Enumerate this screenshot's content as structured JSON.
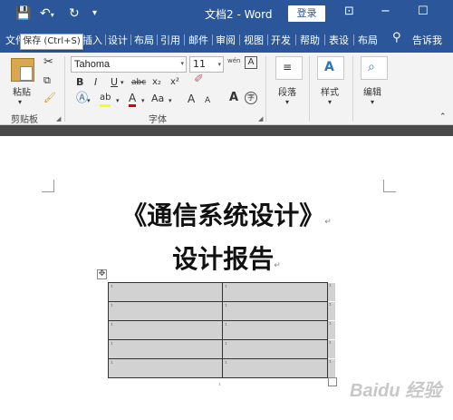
{
  "titlebar": {
    "save_icon": "save-icon",
    "undo_icon": "undo-icon",
    "redo_icon": "redo-icon",
    "customize_icon": "customize-qat-icon",
    "title": "文档2  -  Word",
    "login_label": "登录",
    "ribbon_display_icon": "ribbon-display-icon",
    "minimize_label": "−",
    "maximize_label": "☐"
  },
  "tooltip": "保存 (Ctrl+S)",
  "tabs": [
    "文件",
    "插入",
    "设计",
    "布局",
    "引用",
    "邮件",
    "审阅",
    "视图",
    "开发",
    "帮助",
    "表设",
    "布局"
  ],
  "tell_me_label": "告诉我",
  "ribbon": {
    "clipboard": {
      "paste_label": "粘贴",
      "group_label": "剪贴板"
    },
    "font": {
      "font_name": "Tahoma",
      "font_size": "11",
      "group_label": "字体",
      "pinyin_label": "wén",
      "bold": "B",
      "italic": "I",
      "underline": "U",
      "strikethrough": "abc",
      "subscript": "x₂",
      "superscript": "x²",
      "highlight": "ab",
      "font_color": "A",
      "change_case": "Aa",
      "grow": "A",
      "shrink": "A"
    },
    "paragraph": {
      "label": "段落"
    },
    "styles": {
      "label": "样式"
    },
    "editing": {
      "label": "编辑"
    }
  },
  "document": {
    "title_line1": "《通信系统设计》",
    "title_line2": "设计报告",
    "para_mark": "↵",
    "table_rows": 5,
    "table_cell_mark": "¹",
    "watermark": "Baidu 经验"
  }
}
